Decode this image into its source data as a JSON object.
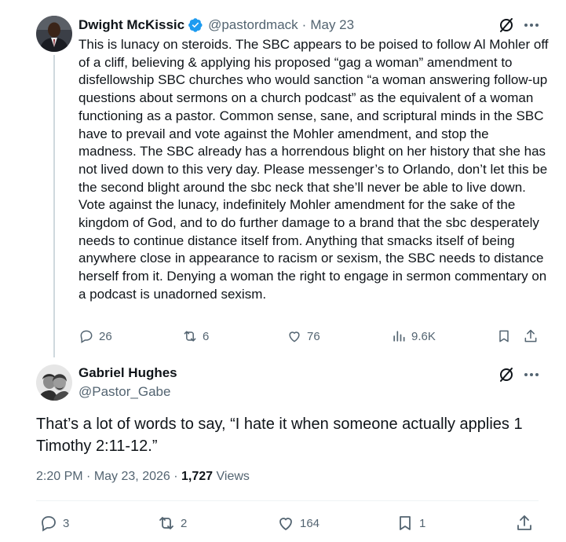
{
  "post1": {
    "author_name": "Dwight McKissic",
    "handle": "@pastordmack",
    "separator": "·",
    "date": "May 23",
    "text": "This is lunacy on steroids. The SBC appears to be poised to follow Al Mohler off of a cliff, believing & applying his proposed “gag a woman” amendment to disfellowship SBC churches who would sanction “a woman answering follow-up questions about sermons on a church podcast” as the equivalent of a woman functioning as a pastor. Common sense, sane, and scriptural minds in the SBC have to prevail and vote against the Mohler amendment, and stop the madness. The SBC already has a horrendous blight on her history that she has not lived down to this very day. Please messenger’s to Orlando, don’t let this be the second blight around the sbc neck that she’ll never be able to live down. Vote against the lunacy, indefinitely Mohler amendment for the sake of the kingdom of God, and to do further damage to a brand that the sbc desperately needs to continue distance itself from. Anything that smacks itself of being anywhere close in appearance to racism or sexism, the SBC needs to distance herself from it. Denying a woman the right to engage in sermon commentary on a podcast is unadorned sexism.",
    "replies": "26",
    "reposts": "6",
    "likes": "76",
    "views": "9.6K",
    "verified_color": "#1d9bf0"
  },
  "post2": {
    "author_name": "Gabriel Hughes",
    "handle": "@Pastor_Gabe",
    "text": "That’s a lot of words to say, “I hate it when someone actually applies 1 Timothy 2:11-12.”",
    "time": "2:20 PM",
    "sep1": "·",
    "date": "May 23, 2026",
    "sep2": "·",
    "views_count": "1,727",
    "views_label": "Views",
    "replies": "3",
    "reposts": "2",
    "likes": "164",
    "bookmarks": "1"
  },
  "icons": [
    "grok-icon",
    "more-icon",
    "reply-icon",
    "repost-icon",
    "like-icon",
    "views-icon",
    "bookmark-icon",
    "share-icon",
    "verified-badge-icon"
  ],
  "colors": {
    "text": "#0f1419",
    "secondary": "#536471",
    "accent": "#1d9bf0",
    "line": "#cfd9de"
  }
}
